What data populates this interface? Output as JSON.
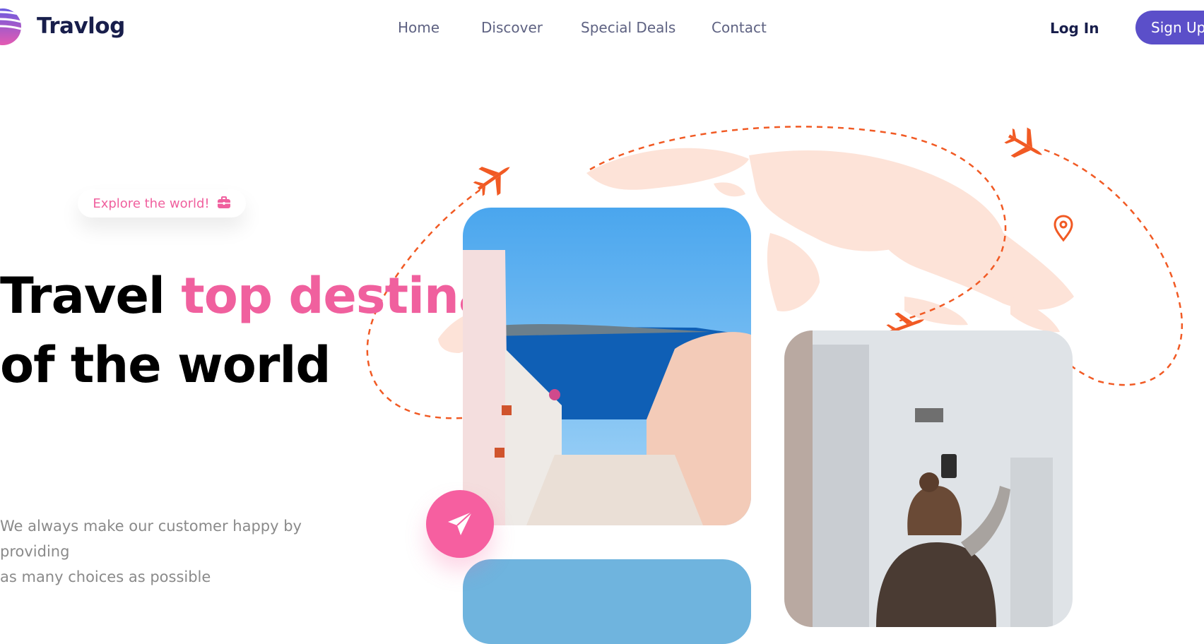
{
  "header": {
    "brand": "Travlog",
    "nav": [
      "Home",
      "Discover",
      "Special Deals",
      "Contact"
    ],
    "login_label": "Log In",
    "signup_label": "Sign Up"
  },
  "hero": {
    "badge": "Explore the world!",
    "title_parts": [
      "Travel ",
      "top destination",
      " of the world"
    ],
    "subtitle_lines": [
      "We always make our customer happy by providing",
      "as many choices as possible"
    ]
  },
  "icons": {
    "logo": "striped-globe-logo",
    "badge_icon": "briefcase-icon",
    "plane": "airplane-icon",
    "pin": "location-pin-icon",
    "send": "paper-plane-icon"
  },
  "colors": {
    "brand": "#181e4b",
    "nav": "#5e6282",
    "accent_pink": "#f0609e",
    "signup": "#5b4fc9",
    "route": "#f15a24",
    "map": "#fde3d8"
  }
}
